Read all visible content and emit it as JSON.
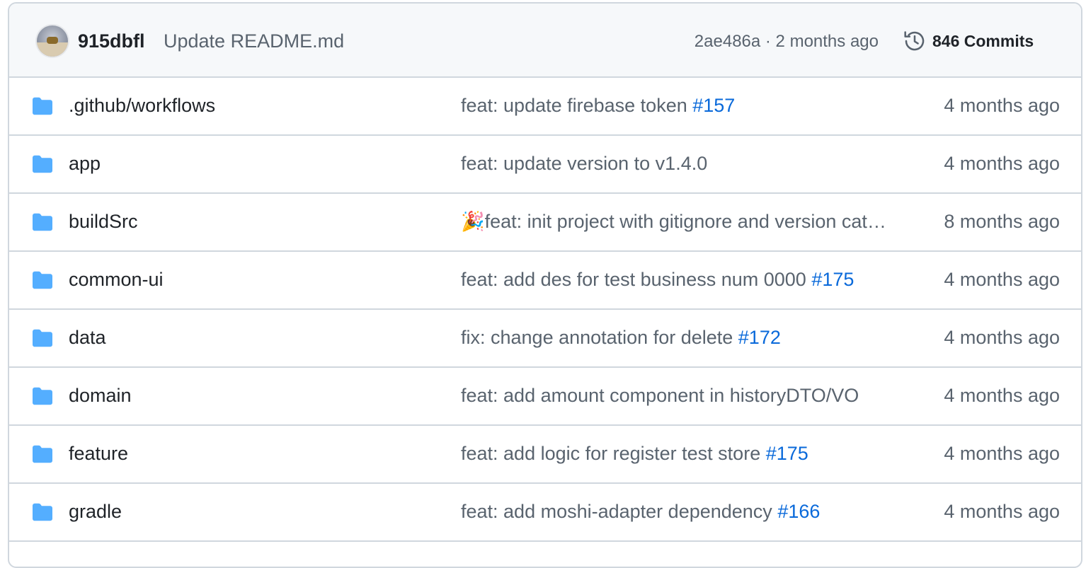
{
  "latest_commit": {
    "author": "915dbfl",
    "message": "Update README.md",
    "meta": "2ae486a · 2 months ago",
    "commits_label": "846 Commits",
    "icons": {
      "avatar": "avatar",
      "history": "history-icon"
    }
  },
  "files": [
    {
      "name": ".github/workflows",
      "message": "feat: update firebase token ",
      "pr": "#157",
      "age": "4 months ago"
    },
    {
      "name": "app",
      "message": "feat: update version to v1.4.0",
      "pr": "",
      "age": "4 months ago"
    },
    {
      "name": "buildSrc",
      "message": "🎉feat: init project with gitignore and version catalog",
      "pr": "",
      "age": "8 months ago"
    },
    {
      "name": "common-ui",
      "message": "feat: add des for test business num 0000 ",
      "pr": "#175",
      "age": "4 months ago"
    },
    {
      "name": "data",
      "message": "fix: change annotation for delete ",
      "pr": "#172",
      "age": "4 months ago"
    },
    {
      "name": "domain",
      "message": "feat: add amount component in historyDTO/VO",
      "pr": "",
      "age": "4 months ago"
    },
    {
      "name": "feature",
      "message": "feat: add logic for register test store ",
      "pr": "#175",
      "age": "4 months ago"
    },
    {
      "name": "gradle",
      "message": "feat: add moshi-adapter dependency ",
      "pr": "#166",
      "age": "4 months ago"
    }
  ],
  "colors": {
    "folder": "#54aeff",
    "link": "#0969da",
    "muted_text": "#59636e",
    "border": "#d0d7de",
    "header_bg": "#f6f8fa"
  }
}
